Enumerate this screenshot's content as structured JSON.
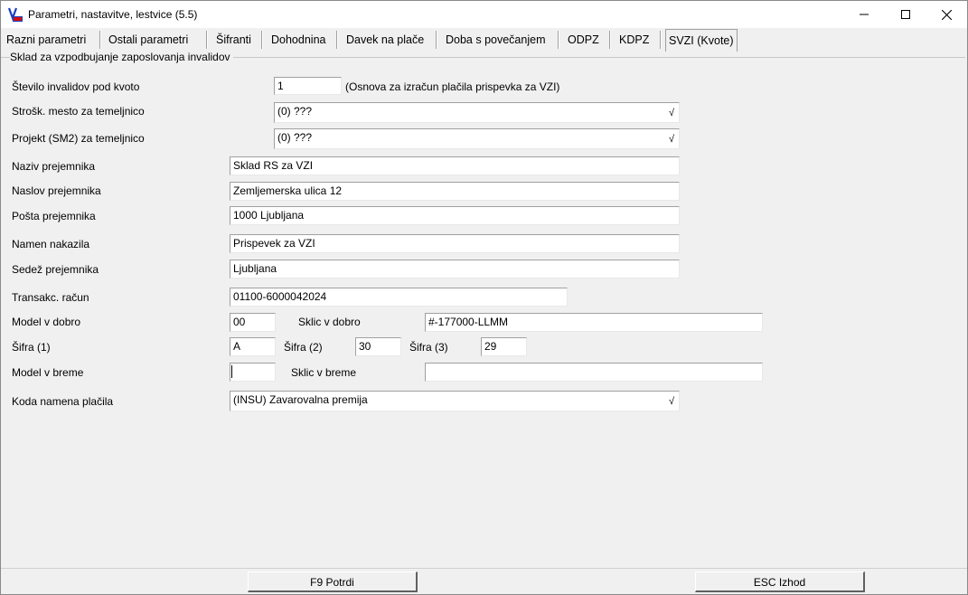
{
  "window": {
    "title": "Parametri, nastavitve, lestvice  (5.5)",
    "minimize_symbol": "—",
    "maximize_symbol": "☐",
    "close_symbol": "✕"
  },
  "tabs": [
    {
      "label": "Razni parametri",
      "active": false
    },
    {
      "label": "Ostali parametri",
      "active": false
    },
    {
      "label": "Šifranti",
      "active": false
    },
    {
      "label": "Dohodnina",
      "active": false
    },
    {
      "label": "Davek na plače",
      "active": false
    },
    {
      "label": "Doba s povečanjem",
      "active": false
    },
    {
      "label": "ODPZ",
      "active": false
    },
    {
      "label": "KDPZ",
      "active": false
    },
    {
      "label": "SVZI (Kvote)",
      "active": true
    }
  ],
  "group": {
    "caption": "Sklad za vzpodbujanje zaposlovanja invalidov"
  },
  "form": {
    "stevilo_invalidov": {
      "label": "Število invalidov pod kvoto",
      "value": "1",
      "note": "(Osnova za izračun plačila prispevka za VZI)"
    },
    "strosk_mesto": {
      "label": "Strošk. mesto za temeljnico",
      "value": "(0) ???"
    },
    "projekt": {
      "label": "Projekt (SM2) za temeljnico",
      "value": "(0) ???"
    },
    "naziv": {
      "label": "Naziv prejemnika",
      "value": "Sklad RS za VZI"
    },
    "naslov": {
      "label": "Naslov prejemnika",
      "value": "Zemljemerska ulica 12"
    },
    "posta": {
      "label": "Pošta prejemnika",
      "value": "1000 Ljubljana"
    },
    "namen": {
      "label": "Namen nakazila",
      "value": "Prispevek za VZI"
    },
    "sedez": {
      "label": "Sedež prejemnika",
      "value": "Ljubljana"
    },
    "racun": {
      "label": "Transakc. račun",
      "value": "01100-6000042024"
    },
    "model_dobro": {
      "label": "Model v dobro",
      "value": "00"
    },
    "sklic_dobro": {
      "label": "Sklic v dobro",
      "value": "#-177000-LLMM"
    },
    "sifra1": {
      "label": "Šifra (1)",
      "value": "A"
    },
    "sifra2": {
      "label": "Šifra (2)",
      "value": "30"
    },
    "sifra3": {
      "label": "Šifra (3)",
      "value": "29"
    },
    "model_breme": {
      "label": "Model v breme",
      "value": ""
    },
    "sklic_breme": {
      "label": "Sklic v breme",
      "value": ""
    },
    "koda_namena": {
      "label": "Koda namena plačila",
      "value": "(INSU) Zavarovalna premija"
    }
  },
  "combo_glyph": "√",
  "buttons": {
    "confirm": "F9  Potrdi",
    "exit": "ESC  Izhod"
  },
  "colors": {
    "background": "#f0f0f0",
    "field": "#ffffff",
    "icon_blue": "#1a3fbf",
    "icon_red": "#d01010"
  }
}
